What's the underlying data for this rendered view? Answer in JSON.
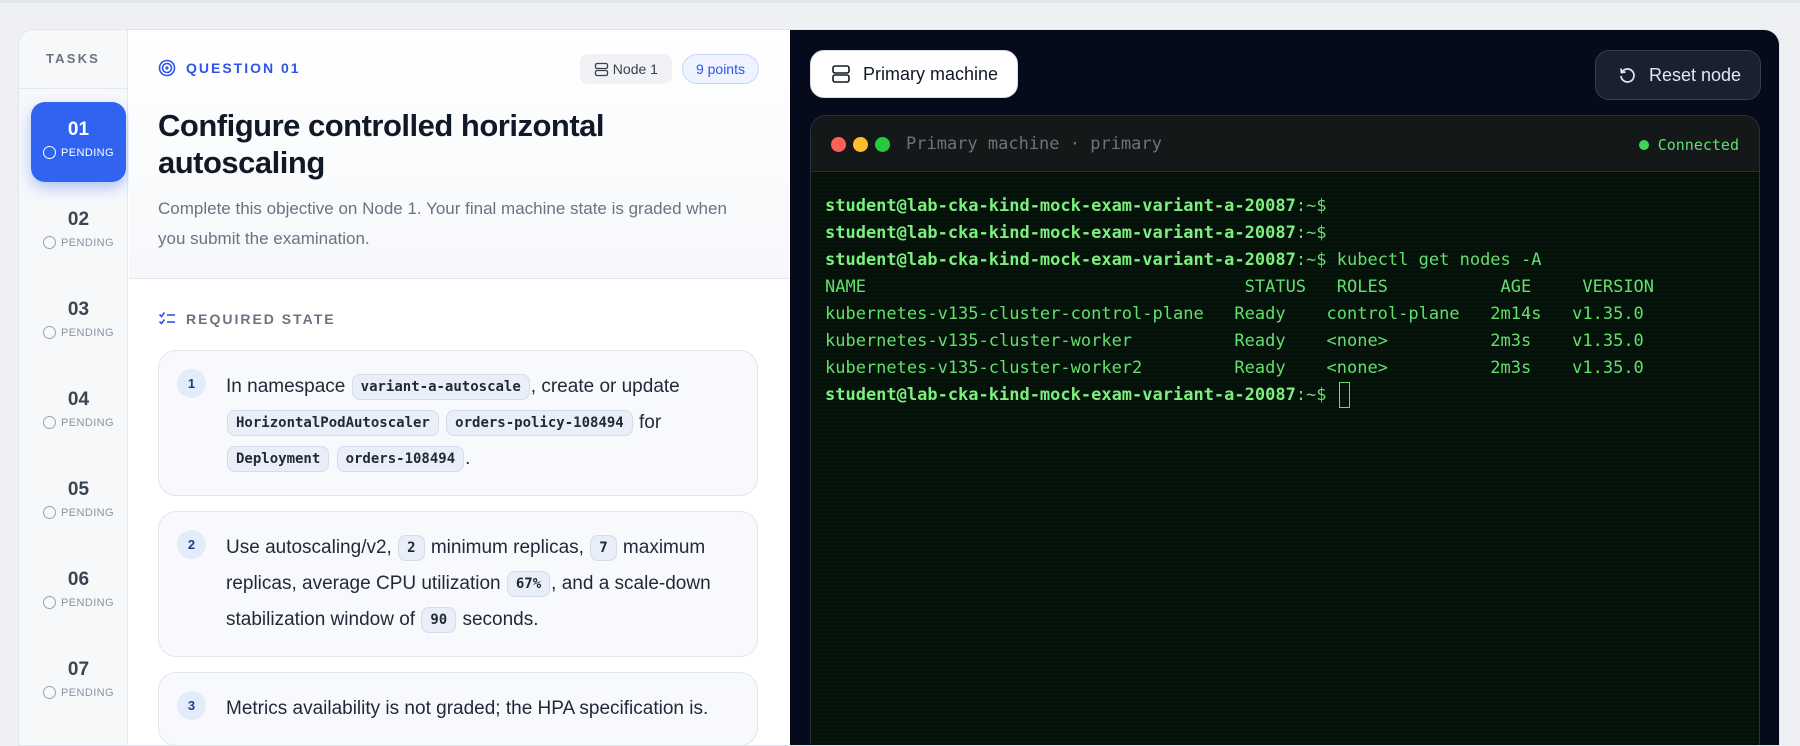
{
  "sidebar": {
    "title": "TASKS",
    "tasks": [
      {
        "num": "01",
        "status": "PENDING"
      },
      {
        "num": "02",
        "status": "PENDING"
      },
      {
        "num": "03",
        "status": "PENDING"
      },
      {
        "num": "04",
        "status": "PENDING"
      },
      {
        "num": "05",
        "status": "PENDING"
      },
      {
        "num": "06",
        "status": "PENDING"
      },
      {
        "num": "07",
        "status": "PENDING"
      }
    ]
  },
  "question": {
    "label": "QUESTION 01",
    "node_chip": "Node 1",
    "points_chip": "9 points",
    "title": "Configure controlled horizontal autoscaling",
    "description": "Complete this objective on Node 1. Your final machine state is graded when you submit the examination.",
    "required_label": "REQUIRED STATE",
    "req1": {
      "idx": "1",
      "t1": "In namespace",
      "c1": "variant-a-autoscale",
      "t2": ", create or update",
      "c2": "HorizontalPodAutoscaler",
      "c3": "orders-policy-108494",
      "t3": "for",
      "c4": "Deployment",
      "c5": "orders-108494",
      "t4": "."
    },
    "req2": {
      "idx": "2",
      "t1": "Use autoscaling/v2,",
      "c1": "2",
      "t2": "minimum replicas,",
      "c2": "7",
      "t3": "maximum replicas, average CPU utilization",
      "c3": "67%",
      "t4": ", and a scale-down stabilization window of",
      "c4": "90",
      "t5": "seconds."
    },
    "req3": {
      "idx": "3",
      "t1": "Metrics availability is not graded; the HPA specification is."
    }
  },
  "terminal_panel": {
    "tab_label": "Primary machine",
    "reset_label": "Reset node",
    "window_title": "Primary machine · primary",
    "status": "Connected",
    "status_color": "#3fd35c",
    "prompt_user": "student@lab-cka-kind-mock-exam-variant-a-20087",
    "prompt_suffix": ":~$",
    "command": "kubectl get nodes -A",
    "header": "NAME                                     STATUS   ROLES           AGE     VERSION",
    "rows": [
      "kubernetes-v135-cluster-control-plane   Ready    control-plane   2m14s   v1.35.0",
      "kubernetes-v135-cluster-worker          Ready    <none>          2m3s    v1.35.0",
      "kubernetes-v135-cluster-worker2         Ready    <none>          2m3s    v1.35.0"
    ]
  },
  "colors": {
    "accent": "#2f63f0",
    "terminal_green": "#63e06c"
  }
}
